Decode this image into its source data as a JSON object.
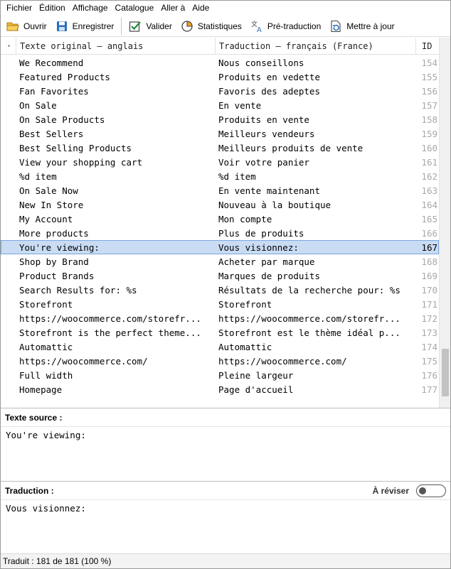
{
  "menu": [
    "Fichier",
    "Édition",
    "Affichage",
    "Catalogue",
    "Aller à",
    "Aide"
  ],
  "toolbar": {
    "open_label": "Ouvrir",
    "save_label": "Enregistrer",
    "validate_label": "Valider",
    "stats_label": "Statistiques",
    "pretranslate_label": "Pré-traduction",
    "update_label": "Mettre à jour"
  },
  "table": {
    "col_dot": "·",
    "col_source": "Texte original — anglais",
    "col_translation": "Traduction — français (France)",
    "col_id": "ID",
    "rows": [
      {
        "source": "We Recommend",
        "translation": "Nous conseillons",
        "id": "154"
      },
      {
        "source": "Featured Products",
        "translation": "Produits en vedette",
        "id": "155"
      },
      {
        "source": "Fan Favorites",
        "translation": "Favoris des adeptes",
        "id": "156"
      },
      {
        "source": "On Sale",
        "translation": "En vente",
        "id": "157"
      },
      {
        "source": "On Sale Products",
        "translation": "Produits en vente",
        "id": "158"
      },
      {
        "source": "Best Sellers",
        "translation": "Meilleurs vendeurs",
        "id": "159"
      },
      {
        "source": "Best Selling Products",
        "translation": "Meilleurs produits de vente",
        "id": "160"
      },
      {
        "source": "View your shopping cart",
        "translation": "Voir votre panier",
        "id": "161"
      },
      {
        "source": "%d item",
        "translation": "%d item",
        "id": "162"
      },
      {
        "source": "On Sale Now",
        "translation": "En vente maintenant",
        "id": "163"
      },
      {
        "source": "New In Store",
        "translation": "Nouveau à la boutique",
        "id": "164"
      },
      {
        "source": "My Account",
        "translation": "Mon compte",
        "id": "165"
      },
      {
        "source": "More products",
        "translation": "Plus de produits",
        "id": "166"
      },
      {
        "source": "You're viewing:",
        "translation": "Vous visionnez:",
        "id": "167",
        "selected": true
      },
      {
        "source": "Shop by Brand",
        "translation": "Acheter par marque",
        "id": "168"
      },
      {
        "source": "Product Brands",
        "translation": "Marques de produits",
        "id": "169"
      },
      {
        "source": "Search Results for: %s",
        "translation": "Résultats de la recherche pour: %s",
        "id": "170"
      },
      {
        "source": "Storefront",
        "translation": "Storefront",
        "id": "171"
      },
      {
        "source": "https://woocommerce.com/storefr...",
        "translation": "https://woocommerce.com/storefr...",
        "id": "172"
      },
      {
        "source": "Storefront is the perfect theme...",
        "translation": "Storefront est le thème idéal p...",
        "id": "173"
      },
      {
        "source": "Automattic",
        "translation": "Automattic",
        "id": "174"
      },
      {
        "source": "https://woocommerce.com/",
        "translation": "https://woocommerce.com/",
        "id": "175"
      },
      {
        "source": "Full width",
        "translation": "Pleine largeur",
        "id": "176"
      },
      {
        "source": "Homepage",
        "translation": "Page d'accueil",
        "id": "177"
      }
    ]
  },
  "source_pane": {
    "header": "Texte source :",
    "text": "You're viewing:"
  },
  "translation_pane": {
    "header": "Traduction :",
    "review_label": "À réviser",
    "text": "Vous visionnez:"
  },
  "status": {
    "text": "Traduit : 181 de 181 (100 %)"
  },
  "colors": {
    "selection": "#c9dcf3",
    "selection_border": "#7aa6de",
    "id_muted": "#a8a8a8"
  }
}
